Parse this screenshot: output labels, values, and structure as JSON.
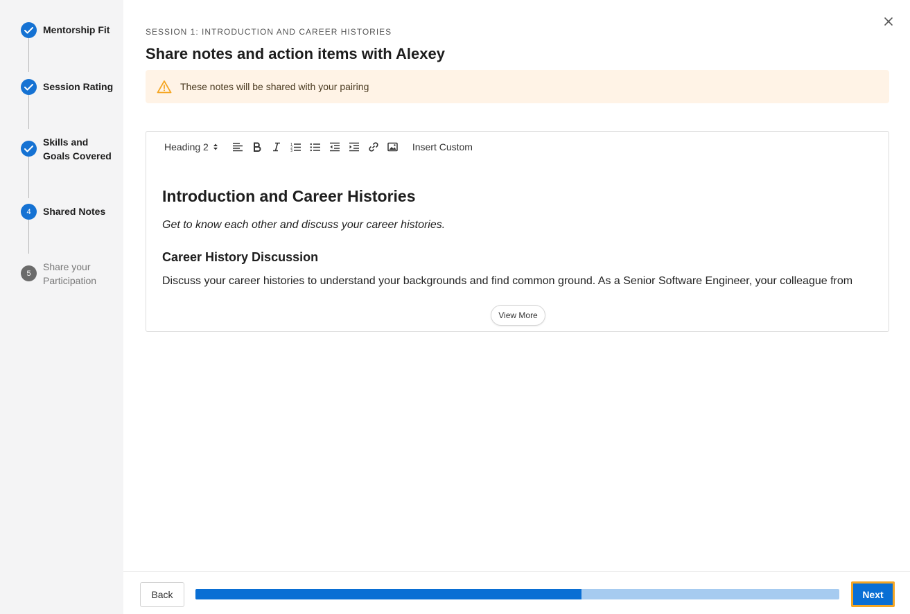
{
  "sidebar": {
    "steps": [
      {
        "label": "Mentorship Fit",
        "status": "done"
      },
      {
        "label": "Session Rating",
        "status": "done"
      },
      {
        "label": "Skills and Goals Covered",
        "status": "done"
      },
      {
        "number": "4",
        "label": "Shared Notes",
        "status": "active"
      },
      {
        "number": "5",
        "label": "Share your Participation",
        "status": "pending"
      }
    ]
  },
  "header": {
    "session_label": "SESSION 1: INTRODUCTION AND CAREER HISTORIES",
    "title": "Share notes and action items with Alexey"
  },
  "warning": {
    "text": "These notes will be shared with your pairing",
    "color": "#f5a623"
  },
  "editor": {
    "toolbar": {
      "heading_select": "Heading 2",
      "icons": [
        "align-left-icon",
        "bold-icon",
        "italic-icon",
        "ordered-list-icon",
        "bullet-list-icon",
        "outdent-icon",
        "indent-icon",
        "link-icon",
        "image-icon"
      ],
      "insert_custom": "Insert Custom"
    },
    "content": {
      "heading": "Introduction and Career Histories",
      "subtitle": "Get to know each other and discuss your career histories.",
      "subheading": "Career History Discussion",
      "body": "Discuss your career histories to understand your backgrounds and find common ground. As a Senior Software Engineer, your colleague from"
    },
    "view_more": "View More"
  },
  "footer": {
    "back_label": "Back",
    "next_label": "Next",
    "progress_fraction": 0.6
  },
  "colors": {
    "primary": "#0a6fd4",
    "progress_track": "#a6cbf0",
    "focus_outline": "#f5a623",
    "warning_bg": "#fff3e6"
  }
}
